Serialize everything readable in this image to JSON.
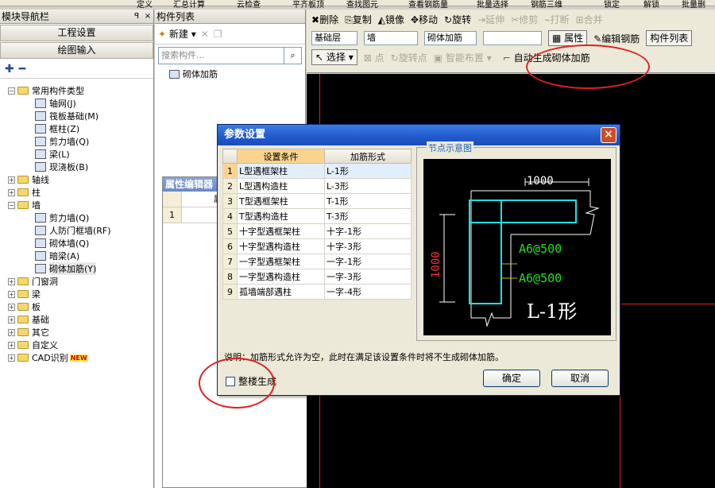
{
  "top_strip": [
    "定义",
    "汇总计算",
    "云检查",
    "平齐板顶",
    "查找图元",
    "查看钢筋量",
    "批量选择",
    "钢筋三维",
    "锁定",
    "解锁",
    "批量删"
  ],
  "nav": {
    "title": "模块导航栏",
    "pin": "ꟼ",
    "close": "×",
    "btn_project": "工程设置",
    "btn_draw": "绘图输入",
    "tree": [
      {
        "label": "常用构件类型",
        "level": 0,
        "toggle": "−",
        "folder": true
      },
      {
        "label": "轴网(J)",
        "level": 1
      },
      {
        "label": "筏板基础(M)",
        "level": 1
      },
      {
        "label": "框柱(Z)",
        "level": 1
      },
      {
        "label": "剪力墙(Q)",
        "level": 1
      },
      {
        "label": "梁(L)",
        "level": 1
      },
      {
        "label": "现浇板(B)",
        "level": 1
      },
      {
        "label": "轴线",
        "level": 0,
        "toggle": "+",
        "folder": true
      },
      {
        "label": "柱",
        "level": 0,
        "toggle": "+",
        "folder": true
      },
      {
        "label": "墙",
        "level": 0,
        "toggle": "−",
        "folder": true
      },
      {
        "label": "剪力墙(Q)",
        "level": 1
      },
      {
        "label": "人防门框墙(RF)",
        "level": 1
      },
      {
        "label": "砌体墙(Q)",
        "level": 1
      },
      {
        "label": "暗梁(A)",
        "level": 1
      },
      {
        "label": "砌体加筋(Y)",
        "level": 1,
        "selected": true
      },
      {
        "label": "门窗洞",
        "level": 0,
        "toggle": "+",
        "folder": true
      },
      {
        "label": "梁",
        "level": 0,
        "toggle": "+",
        "folder": true
      },
      {
        "label": "板",
        "level": 0,
        "toggle": "+",
        "folder": true
      },
      {
        "label": "基础",
        "level": 0,
        "toggle": "+",
        "folder": true
      },
      {
        "label": "其它",
        "level": 0,
        "toggle": "+",
        "folder": true
      },
      {
        "label": "自定义",
        "level": 0,
        "toggle": "+",
        "folder": true
      },
      {
        "label": "CAD识别",
        "level": 0,
        "toggle": "+",
        "folder": true,
        "new": "NEW"
      }
    ]
  },
  "complist": {
    "title": "构件列表",
    "new_label": "新建",
    "search_placeholder": "搜索构件...",
    "item": "砌体加筋"
  },
  "prop_editor": {
    "title": "属性编辑器",
    "col": "属",
    "row1": "1"
  },
  "toolbar": {
    "row1": [
      "删除",
      "复制",
      "镜像",
      "移动",
      "旋转",
      "延伸",
      "修剪",
      "打断",
      "合并"
    ],
    "dd1": "基础层",
    "dd2": "墙",
    "dd3": "砌体加筋",
    "dd4": "",
    "btn_attr": "属性",
    "btn_edit": "编辑钢筋",
    "btn_list": "构件列表",
    "row3": [
      "点",
      "旋转点",
      "智能布置"
    ],
    "select": "选择",
    "auto_gen": "自动生成砌体加筋"
  },
  "dialog": {
    "title": "参数设置",
    "close": "×",
    "col_cond": "设置条件",
    "col_form": "加筋形式",
    "rows": [
      {
        "n": "1",
        "cond": "L型遇框架柱",
        "form": "L-1形"
      },
      {
        "n": "2",
        "cond": "L型遇构造柱",
        "form": "L-3形"
      },
      {
        "n": "3",
        "cond": "T型遇框架柱",
        "form": "T-1形"
      },
      {
        "n": "4",
        "cond": "T型遇构造柱",
        "form": "T-3形"
      },
      {
        "n": "5",
        "cond": "十字型遇框架柱",
        "form": "十字-1形"
      },
      {
        "n": "6",
        "cond": "十字型遇构造柱",
        "form": "十字-3形"
      },
      {
        "n": "7",
        "cond": "一字型遇框架柱",
        "form": "一字-1形"
      },
      {
        "n": "8",
        "cond": "一字型遇构造柱",
        "form": "一字-3形"
      },
      {
        "n": "9",
        "cond": "孤墙端部遇柱",
        "form": "一字-4形"
      }
    ],
    "node_title": "节点示意图",
    "dim_h": "1000",
    "dim_v": "1000",
    "rebar1": "A6@500",
    "rebar2": "A6@500",
    "shape": "L-1形",
    "note": "说明：加筋形式允许为空，此时在满足该设置条件时将不生成砌体加筋。",
    "whole_floor": "整楼生成",
    "ok": "确定",
    "cancel": "取消"
  }
}
